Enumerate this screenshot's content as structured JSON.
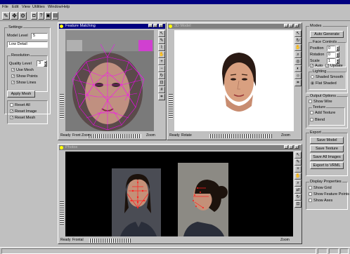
{
  "app": {
    "menu": [
      "File",
      "Edit",
      "View",
      "Utilities",
      "Window",
      "Help"
    ],
    "toolbar_icons": [
      "select-tool-icon",
      "move-tool-icon",
      "settings-tool-icon",
      "camera-icon",
      "help-icon",
      "save-icon",
      "print-icon"
    ]
  },
  "left_panel": {
    "group1_title": "Settings",
    "field1_label": "Model Level",
    "field1_value": "5",
    "combo_value": "Low Detail",
    "group2_title": "Resolution",
    "spinner_label": "Quality Level",
    "spinner_value": "3",
    "checks": [
      {
        "label": "Use Mesh",
        "checked": true
      },
      {
        "label": "Show Points",
        "checked": true
      },
      {
        "label": "Show Lines",
        "checked": true
      }
    ],
    "apply_button": "Apply Mesh",
    "checks2": [
      {
        "label": "Reset All",
        "checked": false
      },
      {
        "label": "Reset Image",
        "checked": true
      },
      {
        "label": "Reset Mesh",
        "checked": true
      }
    ]
  },
  "feature_window": {
    "title": "Feature Matching",
    "status_left": "Ready",
    "status_mid": "Front Zoom",
    "status_right": "Zoom"
  },
  "model_window": {
    "title": "3D Model",
    "status_left": "Ready",
    "status_mid": "Rotate",
    "status_right": "Zoom"
  },
  "photo_window": {
    "title": "Photos",
    "status_left": "Ready",
    "status_mid": "Frontal",
    "status_right": "Zoom"
  },
  "right_panel": {
    "group1_title": "Modes",
    "button1": "Auto Generate",
    "group2_title": "Face Controls",
    "spin_rows": [
      {
        "label": "Position",
        "value": "0"
      },
      {
        "label": "Rotation",
        "value": "0"
      },
      {
        "label": "Scale",
        "value": "1"
      }
    ],
    "check_row": [
      {
        "label": "Auto",
        "checked": true
      },
      {
        "label": "Update",
        "checked": true
      }
    ],
    "group3_title": "Lighting",
    "radios1": [
      {
        "label": "Shaded Smooth",
        "selected": false
      },
      {
        "label": "Flat Shaded",
        "selected": true
      }
    ],
    "group4_title": "Output Options",
    "check_a": {
      "label": "Show Wire",
      "checked": false
    },
    "group5_title": "Texture",
    "checks_b": [
      {
        "label": "Add Texture",
        "checked": false
      },
      {
        "label": "Blend",
        "checked": false
      }
    ],
    "group6_title": "Export",
    "buttons": [
      "Save Model",
      "Save Texture",
      "Save All Images",
      "Export to VRML"
    ],
    "group7_title": "Display Properties",
    "checks_c": [
      {
        "label": "Show Grid",
        "checked": false
      },
      {
        "label": "Show Feature Points",
        "checked": false
      },
      {
        "label": "Show Axes",
        "checked": false
      }
    ]
  },
  "colors": {
    "titlebar_active": "#000080",
    "mesh_magenta": "#ff00ff",
    "feature_red": "#ff2020"
  }
}
